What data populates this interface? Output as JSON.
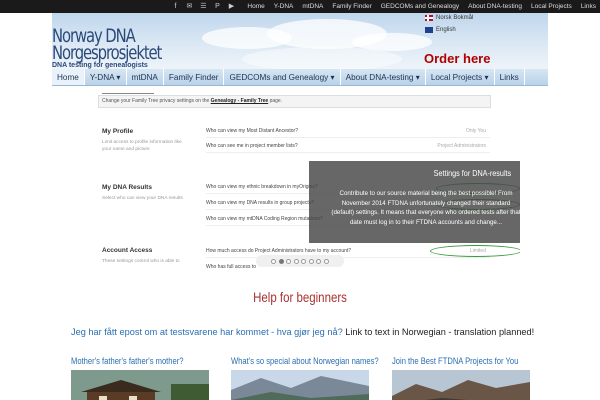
{
  "topbar": {
    "social_icons": [
      "facebook-icon",
      "mail-icon",
      "rss-icon",
      "pinterest-icon",
      "youtube-icon"
    ],
    "social_glyphs": [
      "f",
      "✉",
      "☰",
      "P",
      "▶"
    ],
    "links": [
      "Home",
      "Y-DNA",
      "mtDNA",
      "Family Finder",
      "GEDCOMs and Genealogy",
      "About DNA-testing",
      "Local Projects",
      "Links"
    ]
  },
  "header": {
    "logo_line1": "Norway DNA",
    "logo_line2": "Norgesprosjektet",
    "tagline": "DNA testing for genealogists",
    "lang_no": "Norsk Bokmål",
    "lang_en": "English",
    "order_cta": "Order here"
  },
  "nav": {
    "items": [
      "Home",
      "Y-DNA ▾",
      "mtDNA",
      "Family Finder",
      "GEDCOMs and Genealogy ▾",
      "About DNA-testing ▾",
      "Local Projects ▾",
      "Links"
    ]
  },
  "slider": {
    "note_prefix": "Change your Family Tree privacy settings on the",
    "note_link": "Genealogy - Family Tree",
    "note_suffix": "page.",
    "sections": [
      {
        "title": "My Profile",
        "desc": "Limit access to profile information like your name and picture"
      },
      {
        "title": "My DNA Results",
        "desc": "Select who can view your DNA results"
      },
      {
        "title": "Account Access",
        "desc": "These settings control who is able to"
      }
    ],
    "rows": [
      {
        "q": "Who can view my Most Distant Ancestor?",
        "v": "Only You"
      },
      {
        "q": "Who can see me in project member lists?",
        "v": "Project Administrators"
      },
      {
        "q": "Who can view my ethnic breakdown in myOrigins?",
        "v": ""
      },
      {
        "q": "Who can view my DNA results in group projects?",
        "v": ""
      },
      {
        "q": "Who can view my mtDNA Coding Region mutations?",
        "v": ""
      },
      {
        "q": "How much access do Project Administrators have to my account?",
        "v": "Limited"
      },
      {
        "q": "Who has full access to",
        "v": ""
      }
    ],
    "overlay_title": "Settings for DNA-results",
    "overlay_text": "Contribute to our source material being the best possible! From November 2014 FTDNA unfortunately changed their standard (default) settings. It means that everyone who ordered tests after that date must log in to their FTDNA accounts and change...",
    "slide_count": 8,
    "active_slide": 1,
    "ring_color": "#3a9a3a"
  },
  "main": {
    "help_title": "Help for beginners",
    "faq_question": "Jeg har fått epost om at testsvarene har kommet - hva gjør jeg nå?",
    "faq_rest": " Link to text in Norwegian - translation planned!",
    "columns": [
      {
        "title": "Mother's father's father's mother?"
      },
      {
        "title": "What's so special about Norwegian names?"
      },
      {
        "title": "Join the Best FTDNA Projects for You"
      }
    ]
  },
  "colors": {
    "nav_bg": "#c6dcee",
    "order_red": "#b00000",
    "help_red": "#a83232",
    "link_blue": "#2a6fb0"
  }
}
